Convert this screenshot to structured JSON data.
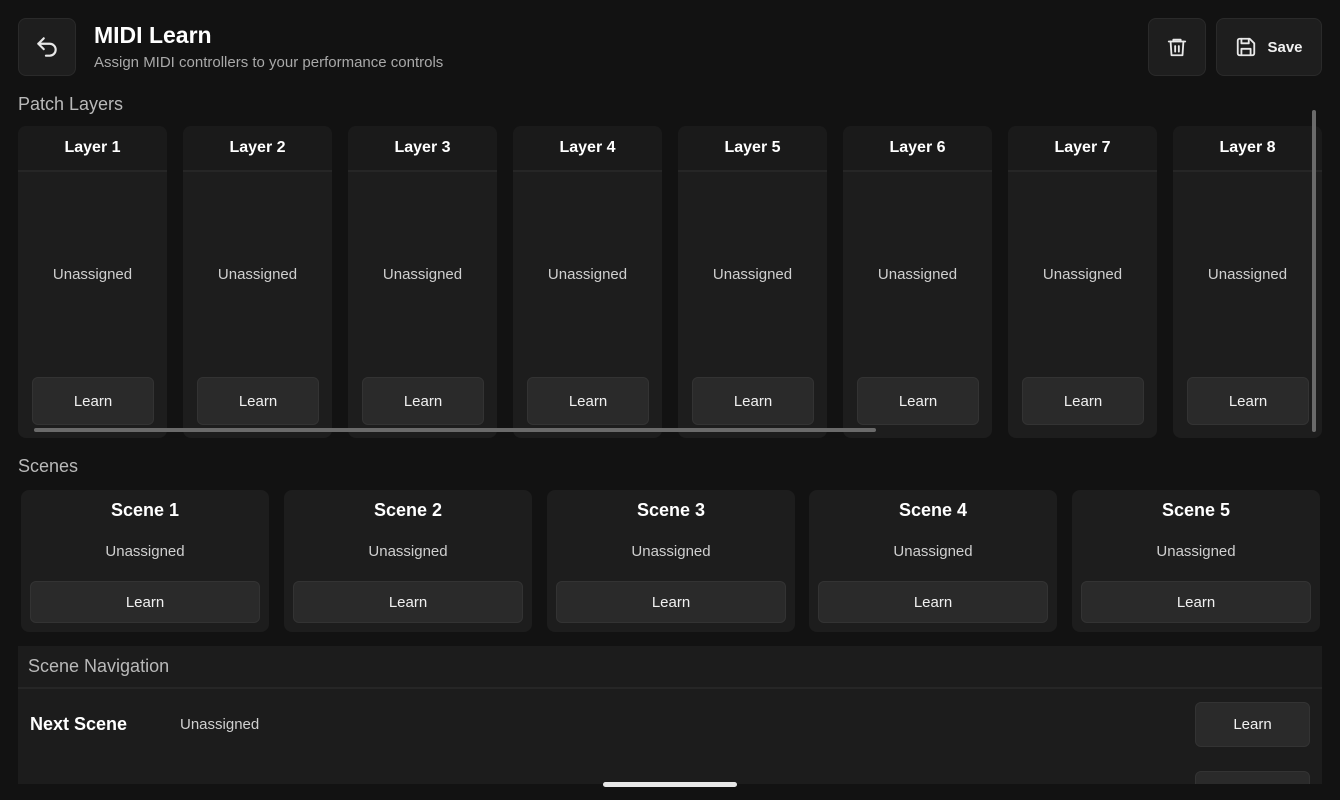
{
  "header": {
    "title": "MIDI Learn",
    "subtitle": "Assign MIDI controllers to your performance controls",
    "save_label": "Save"
  },
  "layers_section": {
    "title": "Patch Layers",
    "items": [
      {
        "name": "Layer 1",
        "status": "Unassigned",
        "learn_label": "Learn"
      },
      {
        "name": "Layer 2",
        "status": "Unassigned",
        "learn_label": "Learn"
      },
      {
        "name": "Layer 3",
        "status": "Unassigned",
        "learn_label": "Learn"
      },
      {
        "name": "Layer 4",
        "status": "Unassigned",
        "learn_label": "Learn"
      },
      {
        "name": "Layer 5",
        "status": "Unassigned",
        "learn_label": "Learn"
      },
      {
        "name": "Layer 6",
        "status": "Unassigned",
        "learn_label": "Learn"
      },
      {
        "name": "Layer 7",
        "status": "Unassigned",
        "learn_label": "Learn"
      },
      {
        "name": "Layer 8",
        "status": "Unassigned",
        "learn_label": "Learn"
      }
    ]
  },
  "scenes_section": {
    "title": "Scenes",
    "items": [
      {
        "name": "Scene 1",
        "status": "Unassigned",
        "learn_label": "Learn"
      },
      {
        "name": "Scene 2",
        "status": "Unassigned",
        "learn_label": "Learn"
      },
      {
        "name": "Scene 3",
        "status": "Unassigned",
        "learn_label": "Learn"
      },
      {
        "name": "Scene 4",
        "status": "Unassigned",
        "learn_label": "Learn"
      },
      {
        "name": "Scene 5",
        "status": "Unassigned",
        "learn_label": "Learn"
      }
    ]
  },
  "scene_navigation": {
    "title": "Scene Navigation",
    "rows": [
      {
        "label": "Next Scene",
        "status": "Unassigned",
        "learn_label": "Learn"
      }
    ]
  },
  "icons": {
    "back": "undo-arrow-icon",
    "delete": "trash-icon",
    "save": "floppy-disk-icon"
  }
}
